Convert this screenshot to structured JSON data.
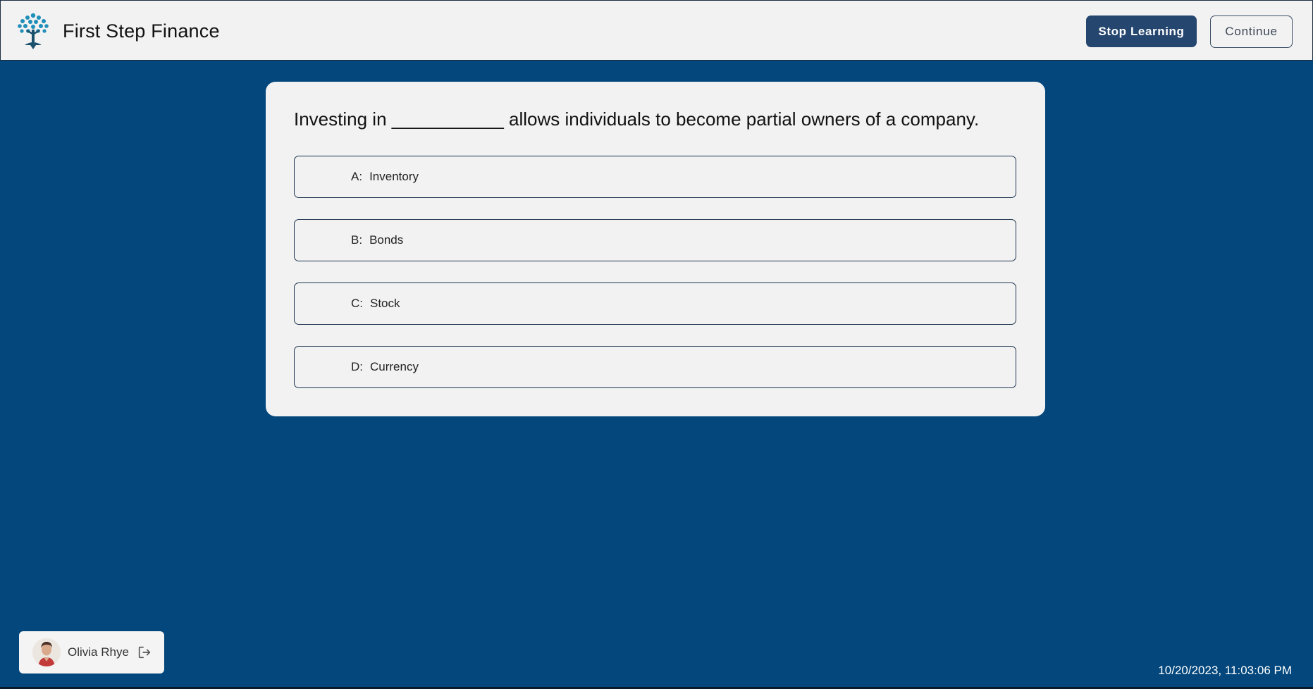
{
  "header": {
    "brand_name": "First Step Finance",
    "logo_icon": "tree-icon",
    "stop_label": "Stop Learning",
    "continue_label": "Continue"
  },
  "quiz": {
    "question": "Investing in ___________ allows individuals to become partial owners of a company.",
    "options": [
      {
        "letter": "A:",
        "text": "Inventory"
      },
      {
        "letter": "B:",
        "text": "Bonds"
      },
      {
        "letter": "C:",
        "text": "Stock"
      },
      {
        "letter": "D:",
        "text": "Currency"
      }
    ]
  },
  "user": {
    "name": "Olivia Rhye",
    "logout_icon": "logout-icon"
  },
  "timestamp": "10/20/2023, 11:03:06 PM",
  "colors": {
    "background": "#03477c",
    "header_bg": "#f2f2f2",
    "primary_button": "#25466e",
    "logo_teal": "#1f7fa8"
  }
}
